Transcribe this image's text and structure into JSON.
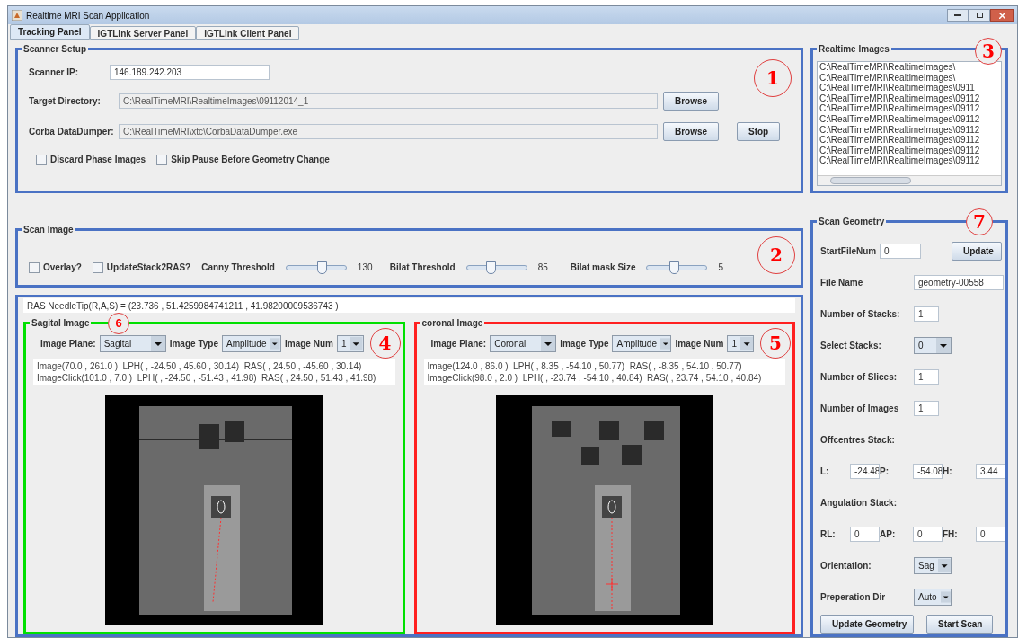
{
  "window": {
    "title": "Realtime MRI Scan Application"
  },
  "tabs": [
    {
      "label": "Tracking Panel",
      "selected": true
    },
    {
      "label": "IGTLink Server Panel",
      "selected": false
    },
    {
      "label": "IGTLink Client Panel",
      "selected": false
    }
  ],
  "scanner_setup": {
    "title": "Scanner Setup",
    "callout": "1",
    "scanner_ip": {
      "label": "Scanner IP:",
      "value": "146.189.242.203"
    },
    "target_directory": {
      "label": "Target Directory:",
      "value": "C:\\RealTimeMRI\\RealtimeImages\\09112014_1",
      "buttons": [
        "Browse"
      ]
    },
    "corba_datadumper": {
      "label": "Corba DataDumper:",
      "value": "C:\\RealTimeMRI\\xtc\\CorbaDataDumper.exe",
      "buttons": [
        "Browse",
        "Stop"
      ]
    },
    "checkboxes": [
      {
        "label": "Discard Phase Images",
        "checked": false
      },
      {
        "label": "Skip Pause Before Geometry Change",
        "checked": false
      }
    ]
  },
  "realtime_images": {
    "title": "Realtime Images",
    "callout": "3",
    "items": [
      "C:\\RealTimeMRI\\RealtimeImages\\",
      "C:\\RealTimeMRI\\RealtimeImages\\",
      "C:\\RealTimeMRI\\RealtimeImages\\0911",
      "C:\\RealTimeMRI\\RealtimeImages\\09112",
      "C:\\RealTimeMRI\\RealtimeImages\\09112",
      "C:\\RealTimeMRI\\RealtimeImages\\09112",
      "C:\\RealTimeMRI\\RealtimeImages\\09112",
      "C:\\RealTimeMRI\\RealtimeImages\\09112",
      "C:\\RealTimeMRI\\RealtimeImages\\09112",
      "C:\\RealTimeMRI\\RealtimeImages\\09112"
    ]
  },
  "scan_image": {
    "title": "Scan Image",
    "callout": "2",
    "checkboxes": [
      {
        "label": "Overlay?",
        "checked": false
      },
      {
        "label": "UpdateStack2RAS?",
        "checked": false
      }
    ],
    "sliders": [
      {
        "label": "Canny Threshold",
        "level": 0.6,
        "reading": "130"
      },
      {
        "label": "Bilat Threshold",
        "level": 0.4,
        "reading": "85"
      },
      {
        "label": "Bilat mask Size",
        "level": 0.45,
        "reading": "5"
      }
    ]
  },
  "needle_tip": {
    "text": "RAS NeedleTip(R,A,S) = (23.736 , 51.4259984741211 , 41.98200009536743 )",
    "callout": "6"
  },
  "image_panels": [
    {
      "title": "Sagital Image",
      "color": "#00e000",
      "callout": "4",
      "plane": {
        "label": "Image Plane:",
        "value": "Sagital"
      },
      "type": {
        "label": "Image Type",
        "value": "Amplitude"
      },
      "num": {
        "label": "Image Num",
        "value": "1"
      },
      "info_lines": [
        "Image(70.0 , 261.0 )  LPH( , -24.50 , 45.60 , 30.14)  RAS( , 24.50 , -45.60 , 30.14)",
        "ImageClick(101.0 , 7.0 )  LPH( , -24.50 , -51.43 , 41.98)  RAS( , 24.50 , 51.43 , 41.98)"
      ]
    },
    {
      "title": "coronal Image",
      "color": "#ff2020",
      "callout": "5",
      "plane": {
        "label": "Image Plane:",
        "value": "Coronal"
      },
      "type": {
        "label": "Image Type",
        "value": "Amplitude"
      },
      "num": {
        "label": "Image Num",
        "value": "1"
      },
      "info_lines": [
        "Image(124.0 , 86.0 )  LPH( , 8.35 , -54.10 , 50.77)  RAS( , -8.35 , 54.10 , 50.77)",
        "ImageClick(98.0 , 2.0 )  LPH( , -23.74 , -54.10 , 40.84)  RAS( , 23.74 , 54.10 , 40.84)"
      ]
    }
  ],
  "scan_geometry": {
    "title": "Scan Geometry",
    "callout": "7",
    "rows": [
      {
        "kind": "field_button",
        "label": "StartFileNum",
        "value": "0",
        "button": "Update"
      },
      {
        "kind": "field",
        "label": "File Name",
        "value": "geometry-00558"
      },
      {
        "kind": "field",
        "label": "Number of Stacks:",
        "value": "1"
      },
      {
        "kind": "dropdown",
        "label": "Select Stacks:",
        "value": "0"
      },
      {
        "kind": "field",
        "label": "Number of Slices:",
        "value": "1"
      },
      {
        "kind": "field",
        "label": "Number of Images",
        "value": "1"
      },
      {
        "kind": "heading",
        "label": "Offcentres Stack:"
      },
      {
        "kind": "triple",
        "fields": [
          {
            "label": "L:",
            "value": "-24.48"
          },
          {
            "label": "P:",
            "value": "-54.08"
          },
          {
            "label": "H:",
            "value": "3.44"
          }
        ]
      },
      {
        "kind": "heading",
        "label": "Angulation Stack:"
      },
      {
        "kind": "triple",
        "fields": [
          {
            "label": "RL:",
            "value": "0"
          },
          {
            "label": "AP:",
            "value": "0"
          },
          {
            "label": "FH:",
            "value": "0"
          }
        ]
      },
      {
        "kind": "dropdown",
        "label": "Orientation:",
        "value": "Sag"
      },
      {
        "kind": "dropdown",
        "label": "Preperation Dir",
        "value": "Auto"
      }
    ],
    "buttons": [
      "Update Geometry",
      "Start Scan"
    ]
  }
}
